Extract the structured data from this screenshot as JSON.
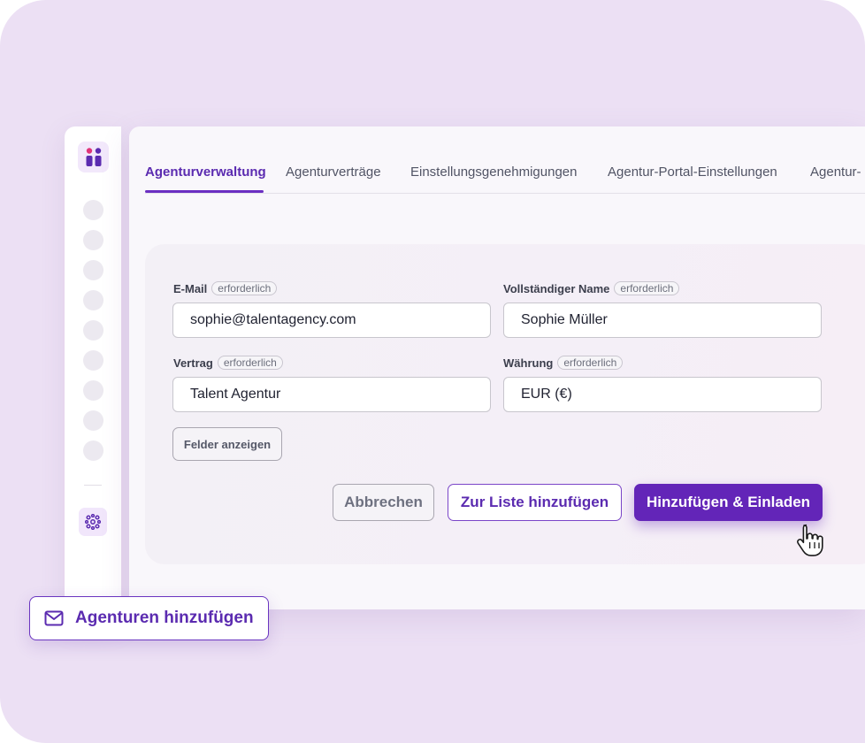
{
  "tabs": [
    {
      "label": "Agenturverwaltung",
      "active": true
    },
    {
      "label": "Agenturverträge",
      "active": false
    },
    {
      "label": "Einstellungsgenehmigungen",
      "active": false
    },
    {
      "label": "Agentur-Portal-Einstellungen",
      "active": false
    },
    {
      "label": "Agentur-",
      "active": false
    }
  ],
  "form": {
    "required_badge": "erforderlich",
    "email": {
      "label": "E-Mail",
      "value": "sophie@talentagency.com"
    },
    "full_name": {
      "label": "Vollständiger Name",
      "value": "Sophie Müller"
    },
    "contract": {
      "label": "Vertrag",
      "value": "Talent Agentur"
    },
    "currency": {
      "label": "Währung",
      "value": "EUR (€)"
    },
    "show_fields_label": "Felder anzeigen",
    "cancel_label": "Abbrechen",
    "add_to_list_label": "Zur Liste hinzufügen",
    "add_invite_label": "Hinzufügen & Einladen"
  },
  "chip": {
    "label": "Agenturen hinzufügen",
    "icon": "mail-icon"
  },
  "sidebar": {
    "logo_icon": "people-logo-icon",
    "settings_icon": "network-settings-icon",
    "nav_item_count": 9
  },
  "colors": {
    "accent": "#6325b8",
    "background": "#ece0f4",
    "logo_pink": "#e0337a",
    "logo_purple": "#5b2bb0"
  }
}
